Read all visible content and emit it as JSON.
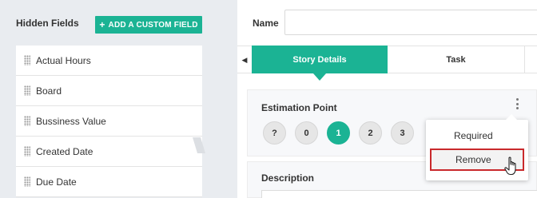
{
  "left_panel": {
    "title": "Hidden Fields",
    "add_button_label": "ADD A CUSTOM FIELD",
    "fields": [
      {
        "label": "Actual Hours"
      },
      {
        "label": "Board"
      },
      {
        "label": "Bussiness Value"
      },
      {
        "label": "Created Date"
      },
      {
        "label": "Due Date"
      }
    ]
  },
  "right_panel": {
    "name_label": "Name",
    "name_value": "",
    "tabs": [
      {
        "label": "Story Details",
        "active": true
      },
      {
        "label": "Task",
        "active": false
      }
    ],
    "estimation": {
      "label": "Estimation Point",
      "points": [
        "?",
        "0",
        "1",
        "2",
        "3"
      ],
      "selected": "1"
    },
    "description": {
      "label": "Description"
    }
  },
  "menu": {
    "items": [
      {
        "label": "Required"
      },
      {
        "label": "Remove"
      }
    ]
  },
  "colors": {
    "accent": "#1bb394",
    "highlight_border": "#c9292c"
  },
  "icons": {
    "drag": "drag-handle-icon",
    "plus": "plus-icon",
    "prev": "caret-left-icon",
    "more": "more-vertical-icon",
    "cursor": "hand-pointer-icon"
  }
}
